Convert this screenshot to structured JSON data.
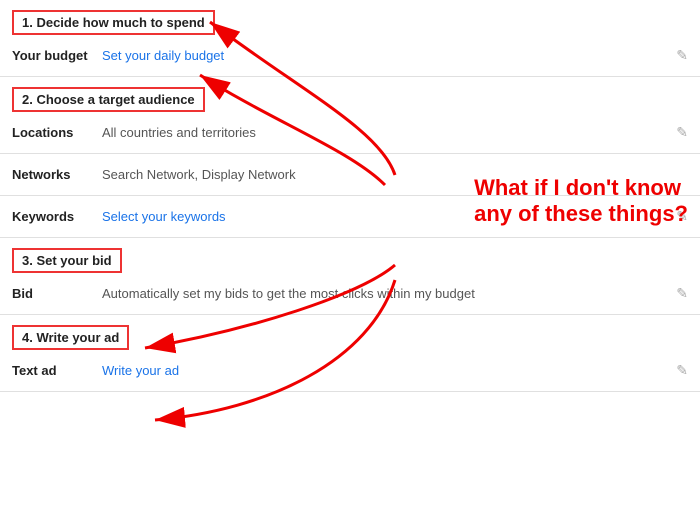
{
  "sections": [
    {
      "id": "section-1",
      "header_label": "1. Decide how much to spend",
      "rows": [
        {
          "label": "Your budget",
          "value": "Set your daily budget",
          "value_type": "link",
          "editable": true
        }
      ]
    },
    {
      "id": "section-2",
      "header_label": "2. Choose a target audience",
      "rows": [
        {
          "label": "Locations",
          "value": "All countries and territories",
          "value_type": "text",
          "editable": true
        },
        {
          "label": "Networks",
          "value": "Search Network, Display Network",
          "value_type": "text",
          "editable": false
        },
        {
          "label": "Keywords",
          "value": "Select your keywords",
          "value_type": "link",
          "editable": true
        }
      ]
    },
    {
      "id": "section-3",
      "header_label": "3. Set your bid",
      "rows": [
        {
          "label": "Bid",
          "value": "Automatically set my bids to get the most clicks within my budget",
          "value_type": "text",
          "editable": true
        }
      ]
    },
    {
      "id": "section-4",
      "header_label": "4. Write your ad",
      "rows": [
        {
          "label": "Text ad",
          "value": "Write your ad",
          "value_type": "link",
          "editable": true
        }
      ]
    }
  ],
  "callout": {
    "text": "What if I don't know\nany of these things?"
  },
  "edit_icon": "✎"
}
